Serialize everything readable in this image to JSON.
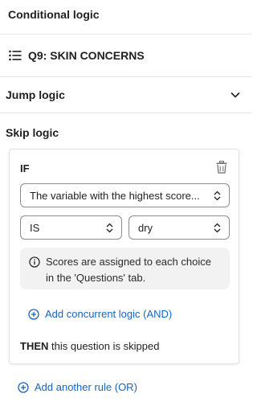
{
  "header": {
    "title": "Conditional logic"
  },
  "question": {
    "icon": "list-icon",
    "title": "Q9: SKIN CONCERNS"
  },
  "jump_logic": {
    "label": "Jump logic",
    "icon": "chevron-down-icon"
  },
  "skip_logic": {
    "title": "Skip logic",
    "rule": {
      "if_label": "IF",
      "variable_select": "The variable with the highest score...",
      "operator_select": "IS",
      "value_select": "dry",
      "info_text": "Scores are assigned to each choice in the 'Questions' tab.",
      "add_and_label": "Add concurrent logic (AND)",
      "then_keyword": "THEN",
      "then_text": "this question is skipped"
    },
    "add_or_label": "Add another rule (OR)"
  },
  "colors": {
    "link": "#1565c0",
    "border": "#e6e6e6",
    "info_bg": "#f2f2f2"
  }
}
